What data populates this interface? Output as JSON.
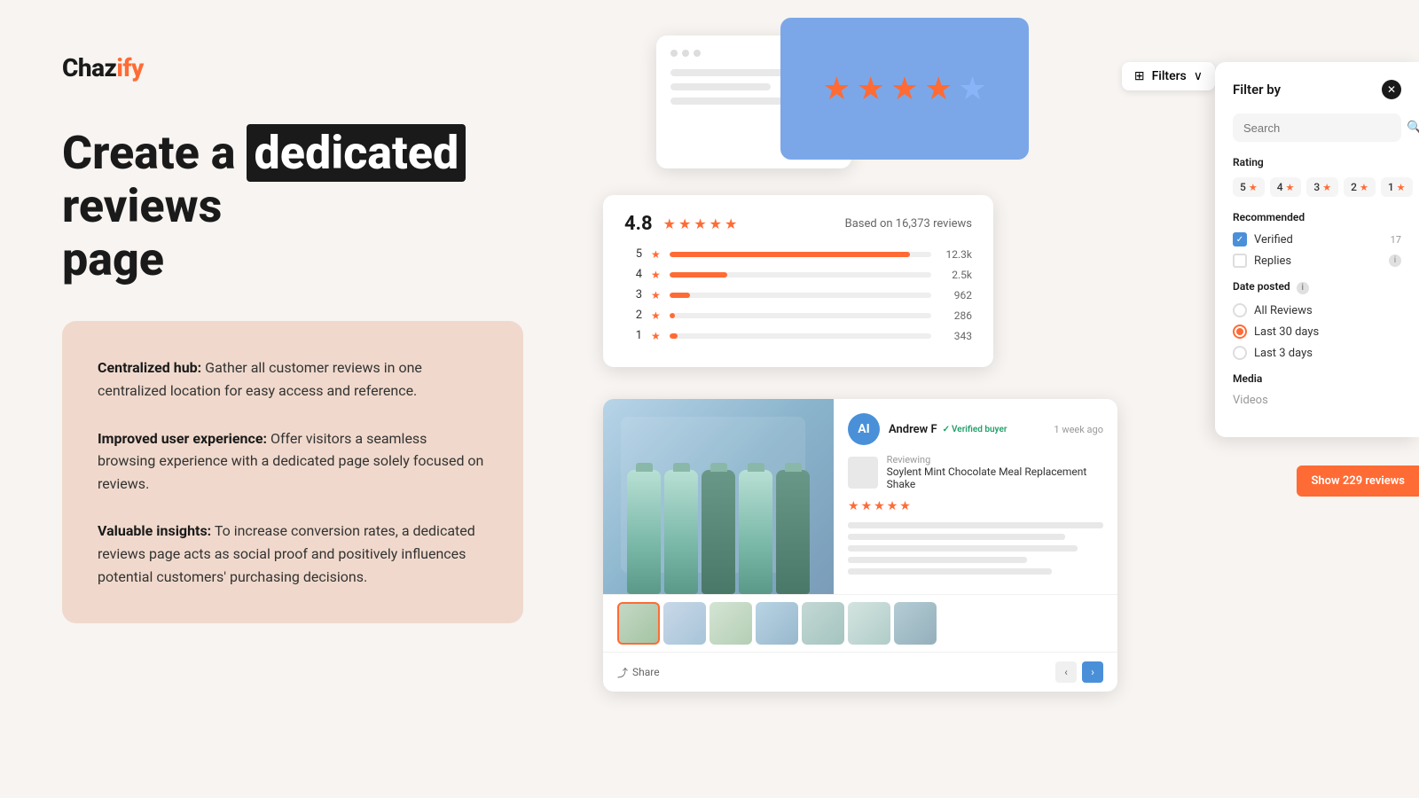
{
  "brand": {
    "logo_text": "Chazify",
    "logo_accent": "ify"
  },
  "headline": {
    "part1": "Create a ",
    "highlight": "dedicated",
    "part2": " reviews",
    "part3": "page"
  },
  "features": [
    {
      "title": "Centralized hub:",
      "text": " Gather all customer reviews in one centralized location for easy access and reference."
    },
    {
      "title": "Improved user experience:",
      "text": " Offer visitors a seamless browsing experience with a dedicated page solely focused on reviews."
    },
    {
      "title": "Valuable insights:",
      "text": " To increase conversion rates, a dedicated reviews page acts as social proof and positively influences potential customers' purchasing decisions."
    }
  ],
  "rating_panel": {
    "score": "4.8",
    "total_label": "Based on 16,373 reviews",
    "bars": [
      {
        "label": "5",
        "fill_pct": 92,
        "count": "12.3k"
      },
      {
        "label": "4",
        "fill_pct": 22,
        "count": "2.5k"
      },
      {
        "label": "3",
        "fill_pct": 8,
        "count": "962"
      },
      {
        "label": "2",
        "fill_pct": 2,
        "count": "286"
      },
      {
        "label": "1",
        "fill_pct": 3,
        "count": "343"
      }
    ]
  },
  "review_card": {
    "reviewer_initial": "AI",
    "reviewer_name": "Andrew F",
    "verified_label": "Verified buyer",
    "time_ago": "1 week ago",
    "reviewing_label": "Reviewing",
    "product_name": "Soylent Mint Chocolate Meal Replacement Shake",
    "star_count": 5,
    "share_label": "Share",
    "thumbnails": 7
  },
  "filter_panel": {
    "trigger_label": "Filters",
    "title": "Filter by",
    "search_placeholder": "Search",
    "rating_section_title": "Rating",
    "rating_chips": [
      "5",
      "4",
      "3",
      "2",
      "1"
    ],
    "recommended_title": "Recommended",
    "checkboxes": [
      {
        "label": "Verified",
        "count": "17",
        "checked": true
      },
      {
        "label": "Replies",
        "count": "",
        "checked": false
      }
    ],
    "date_title": "Date posted",
    "date_options": [
      {
        "label": "All Reviews",
        "checked": false
      },
      {
        "label": "Last 30 days",
        "checked": true
      },
      {
        "label": "Last 3 days",
        "checked": false
      }
    ],
    "media_title": "Media",
    "media_placeholder": "Videos"
  },
  "show_reviews_btn": "Show 229 reviews"
}
